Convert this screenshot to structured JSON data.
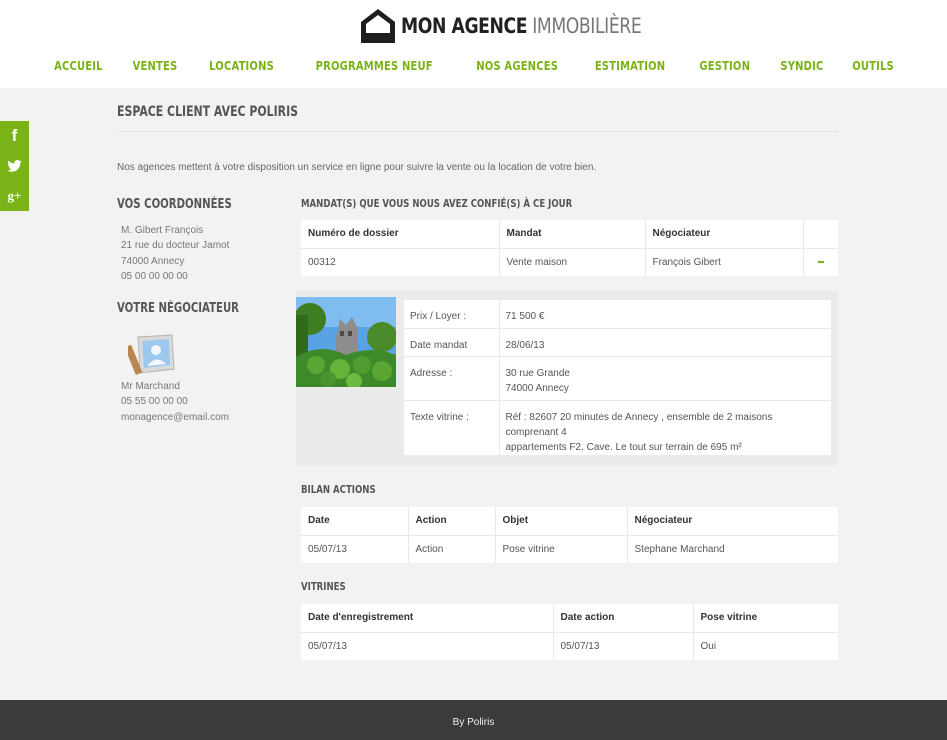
{
  "brand": {
    "name_bold": "MON AGENCE",
    "name_light": "IMMOBILIÈRE",
    "accent": "#7ab317"
  },
  "nav": [
    "ACCUEIL",
    "VENTES",
    "LOCATIONS",
    "PROGRAMMES NEUF",
    "NOS AGENCES",
    "ESTIMATION",
    "GESTION",
    "SYNDIC",
    "OUTILS"
  ],
  "social": {
    "facebook": "f",
    "twitter": "twitter-icon",
    "google": "g+"
  },
  "page": {
    "title": "ESPACE CLIENT AVEC POLIRIS",
    "intro": "Nos agences mettent à votre disposition un service en ligne pour suivre la vente ou la location de votre bien."
  },
  "coordonnees": {
    "heading": "VOS COORDONNÉES",
    "lines": [
      "M. Gibert François",
      "21 rue du docteur Jamot",
      "74000 Annecy",
      "05 00 00 00 00"
    ]
  },
  "negociateur": {
    "heading": "VOTRE NÉGOCIATEUR",
    "lines": [
      "Mr Marchand",
      "05 55 00 00 00",
      "monagence@email.com"
    ]
  },
  "mandats": {
    "heading": "MANDAT(S) QUE VOUS NOUS AVEZ CONFIÉ(S) À CE JOUR",
    "headers": [
      "Numéro de dossier",
      "Mandat",
      "Négociateur"
    ],
    "row": [
      "00312",
      "Vente maison",
      "François Gibert"
    ]
  },
  "detail": {
    "rows": [
      {
        "k": "Prix / Loyer :",
        "v": "71 500 €"
      },
      {
        "k": "Date mandat",
        "v": "28/06/13"
      },
      {
        "k": "Adresse :",
        "v": "30 rue Grande",
        "v2": "74000 Annecy"
      },
      {
        "k": "Texte vitrine :",
        "v": "Réf : 82607 20 minutes de Annecy , ensemble de 2 maisons comprenant 4",
        "v2": "appartements F2. Cave. Le tout sur terrain de 695 m²"
      }
    ]
  },
  "bilan": {
    "heading": "BILAN ACTIONS",
    "headers": [
      "Date",
      "Action",
      "Objet",
      "Négociateur"
    ],
    "row": [
      "05/07/13",
      "Action",
      "Pose vitrine",
      "Stephane Marchand"
    ]
  },
  "vitrines": {
    "heading": "VITRINES",
    "headers": [
      "Date d'enregistrement",
      "Date action",
      "Pose vitrine"
    ],
    "row": [
      "05/07/13",
      "05/07/13",
      "Oui"
    ]
  },
  "footer": "By Poliris"
}
